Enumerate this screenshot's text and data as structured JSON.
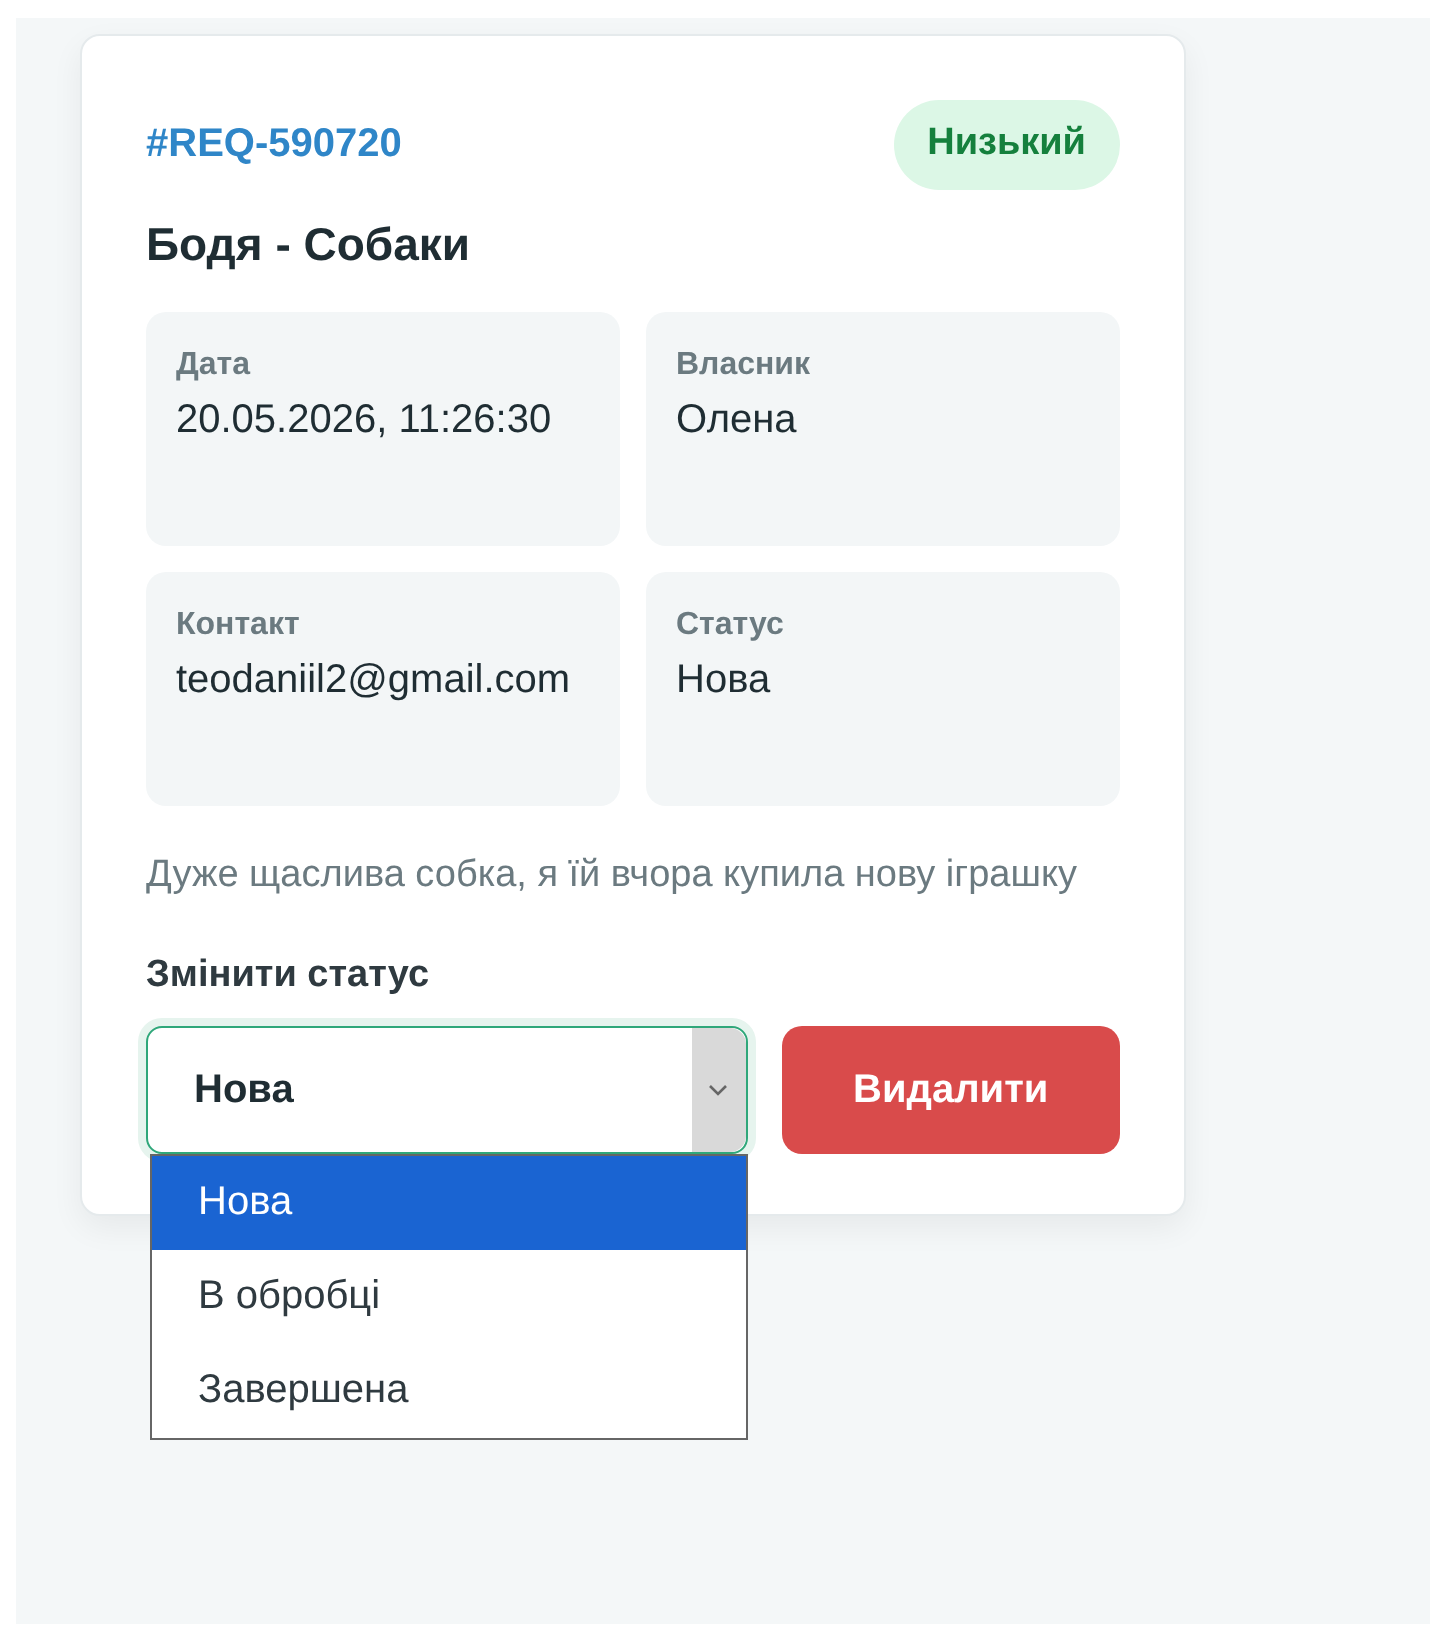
{
  "card": {
    "id": "#REQ-590720",
    "priority": {
      "label": "Низький",
      "color": "#15803d"
    },
    "title": "Бодя - Собаки",
    "fields": [
      {
        "label": "Дата",
        "value": "20.05.2026, 11:26:30"
      },
      {
        "label": "Власник",
        "value": "Олена"
      },
      {
        "label": "Контакт",
        "value": "teodaniil2@gmail.com"
      },
      {
        "label": "Статус",
        "value": "Нова"
      }
    ],
    "description": "Дуже щаслива собка, я їй вчора купила нову іграшку",
    "status_label": "Змінити статус",
    "status_select": {
      "value": "Нова",
      "expanded": true,
      "options": [
        {
          "label": "Нова",
          "selected": true
        },
        {
          "label": "В обробці",
          "selected": false
        },
        {
          "label": "Завершена",
          "selected": false
        }
      ]
    },
    "delete_button": "Видалити"
  }
}
